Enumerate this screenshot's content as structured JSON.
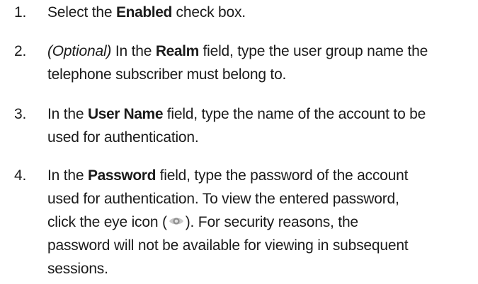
{
  "steps": [
    {
      "number": "1.",
      "lines": [
        {
          "pre": "Select the ",
          "bold": "Enabled",
          "post": " check box."
        }
      ]
    },
    {
      "number": "2.",
      "optional": "(Optional)",
      "line1_pre": " In the ",
      "bold": "Realm",
      "line1_post": " field, type the user group name the",
      "line2": "telephone subscriber must belong to."
    },
    {
      "number": "3.",
      "line1_pre": "In the ",
      "bold": "User Name",
      "line1_post": " field, type the name of the account to be",
      "line2": "used for authentication."
    },
    {
      "number": "4.",
      "line1_pre": "In the ",
      "bold": "Password",
      "line1_post": " field, type the password of the account",
      "line2": "used for authentication. To view the entered password,",
      "line3_pre": "click the eye icon (",
      "line3_post": "). For security reasons, the",
      "line4": "password will not be available for viewing in subsequent",
      "line5": "sessions."
    }
  ],
  "icons": {
    "eye": "eye-icon"
  }
}
